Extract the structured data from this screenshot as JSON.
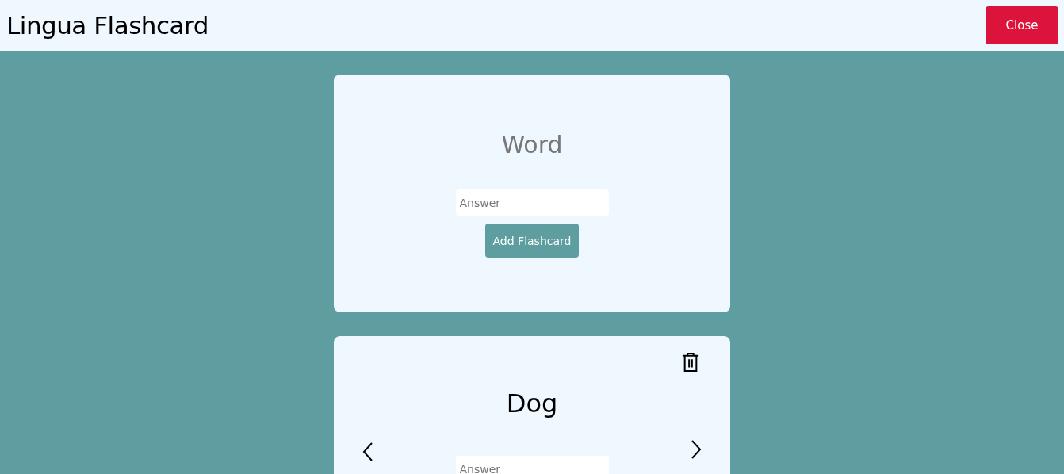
{
  "header": {
    "title": "Lingua Flashcard",
    "close_button": "Close"
  },
  "new_card": {
    "word_placeholder": "Word",
    "answer_placeholder": "Answer",
    "add_button": "Add Flashcard"
  },
  "flashcards": [
    {
      "word": "Dog",
      "answer_placeholder": "Answer"
    }
  ]
}
